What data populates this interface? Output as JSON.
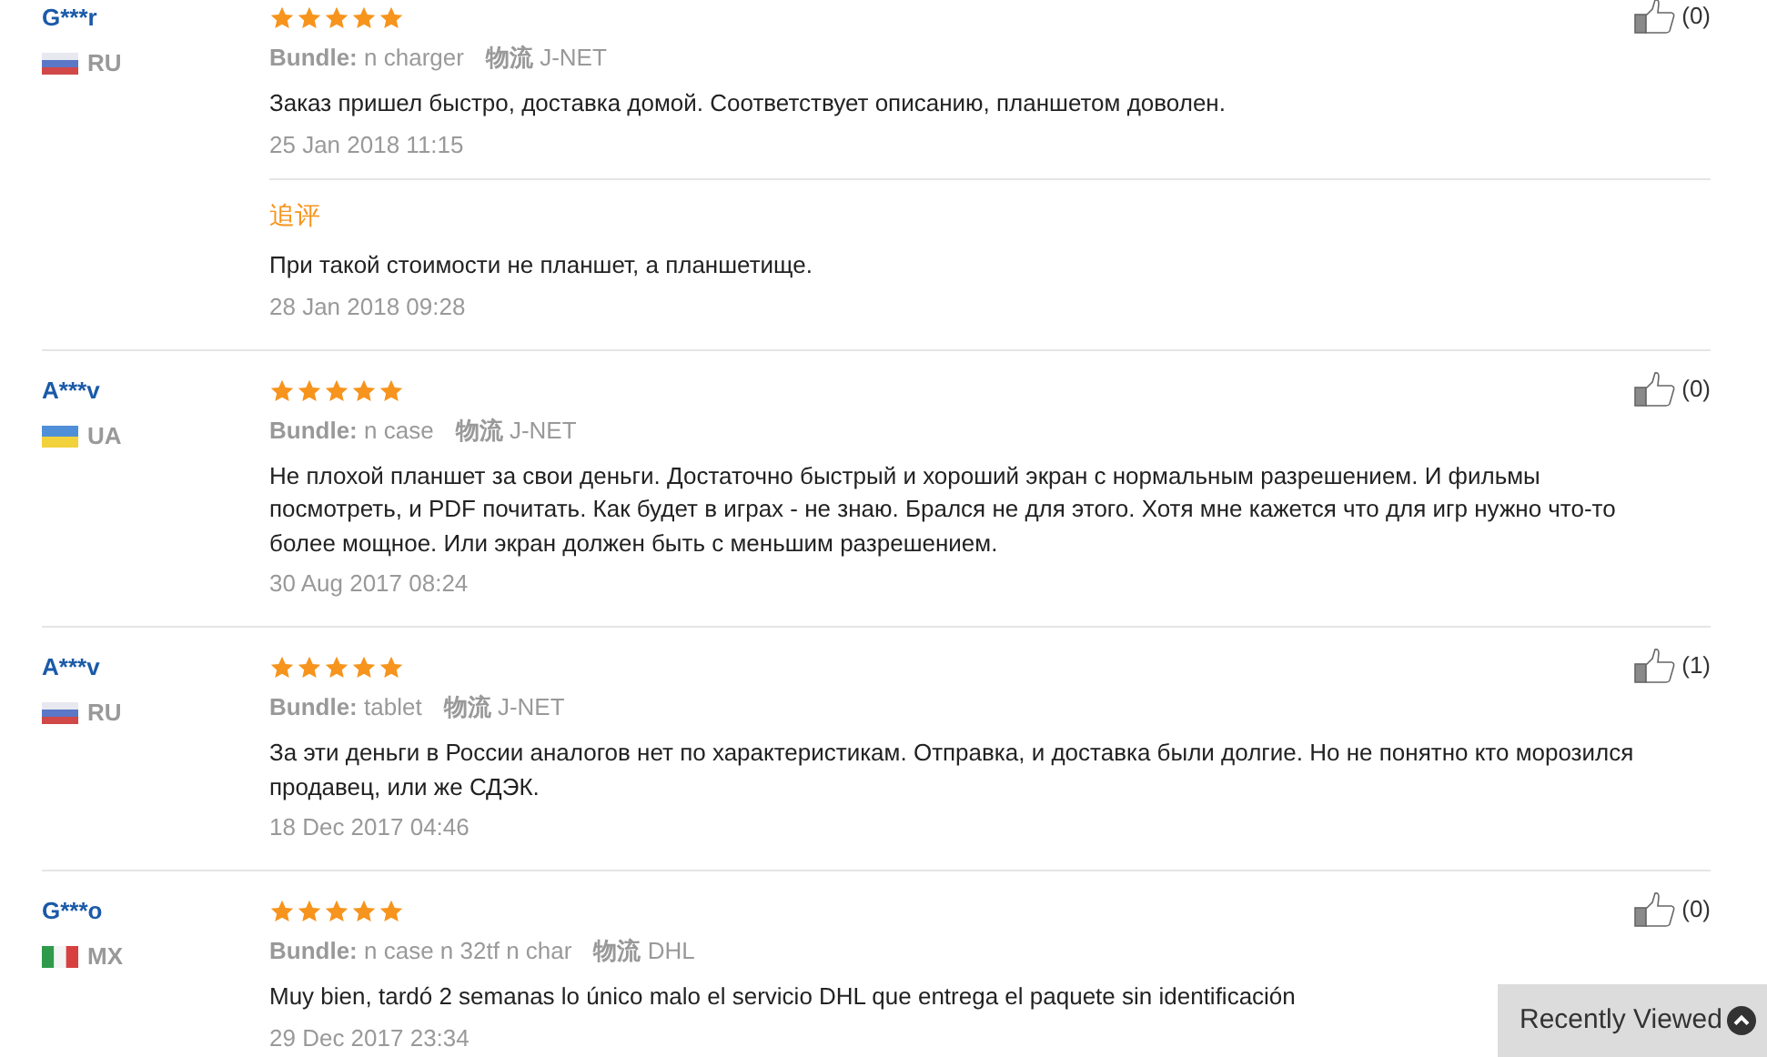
{
  "reviews": [
    {
      "user": "G***r",
      "kind": "ru",
      "country": "RU",
      "stars": 5,
      "bundle_label": "Bundle:",
      "bundle": "n charger",
      "shipping_label": "物流",
      "shipping": "J-NET",
      "text": "Заказ пришел быстро, доставка домой. Соответствует описанию, планшетом доволен.",
      "date": "25 Jan 2018 11:15",
      "likes": "(0)",
      "follow_up": {
        "label": "追评",
        "text": "При такой стоимости не планшет, а планшетище.",
        "date": "28 Jan 2018 09:28"
      }
    },
    {
      "user": "A***v",
      "kind": "ua",
      "country": "UA",
      "stars": 5,
      "bundle_label": "Bundle:",
      "bundle": "n case",
      "shipping_label": "物流",
      "shipping": "J-NET",
      "text": "Не плохой планшет за свои деньги. Достаточно быстрый и хороший экран с нормальным разрешением. И фильмы посмотреть, и PDF почитать. Как будет в играх - не знаю. Брался не для этого. Хотя мне кажется что для игр нужно что-то более мощное. Или экран должен быть с меньшим разрешением.",
      "date": "30 Aug 2017 08:24",
      "likes": "(0)"
    },
    {
      "user": "A***v",
      "kind": "ru",
      "country": "RU",
      "stars": 5,
      "bundle_label": "Bundle:",
      "bundle": "tablet",
      "shipping_label": "物流",
      "shipping": "J-NET",
      "text": "За эти деньги в России аналогов нет по характеристикам. Отправка, и доставка были долгие. Но не понятно кто морозился продавец, или же СДЭК.",
      "date": "18 Dec 2017 04:46",
      "likes": "(1)"
    },
    {
      "user": "G***o",
      "kind": "mx",
      "country": "MX",
      "stars": 5,
      "bundle_label": "Bundle:",
      "bundle": "n case n 32tf n char",
      "shipping_label": "物流",
      "shipping": "DHL",
      "text": "Muy bien, tardó 2 semanas lo único malo el servicio DHL que entrega el paquete sin identificación",
      "date": "29 Dec 2017 23:34",
      "likes": "(0)"
    }
  ],
  "recently_viewed": {
    "label": "Recently Viewed"
  }
}
